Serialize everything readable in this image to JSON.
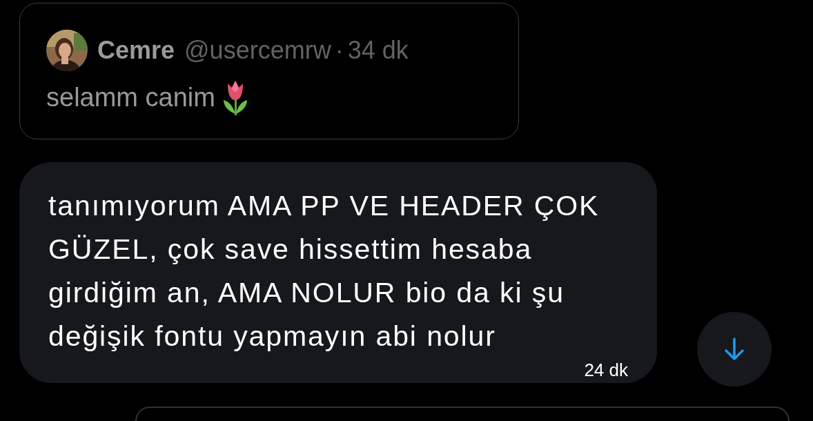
{
  "quoted_post": {
    "author": {
      "name": "Cemre",
      "handle": "@usercemrw",
      "separator": "·",
      "time": "34 dk"
    },
    "text": "selamm canim"
  },
  "message": {
    "text": "tanımıyorum AMA PP VE HEADER ÇOK GÜZEL, çok save hissettim hesaba girdiğim an, AMA NOLUR bio da ki şu değişik fontu yapmayın abi nolur",
    "time": "24 dk"
  }
}
